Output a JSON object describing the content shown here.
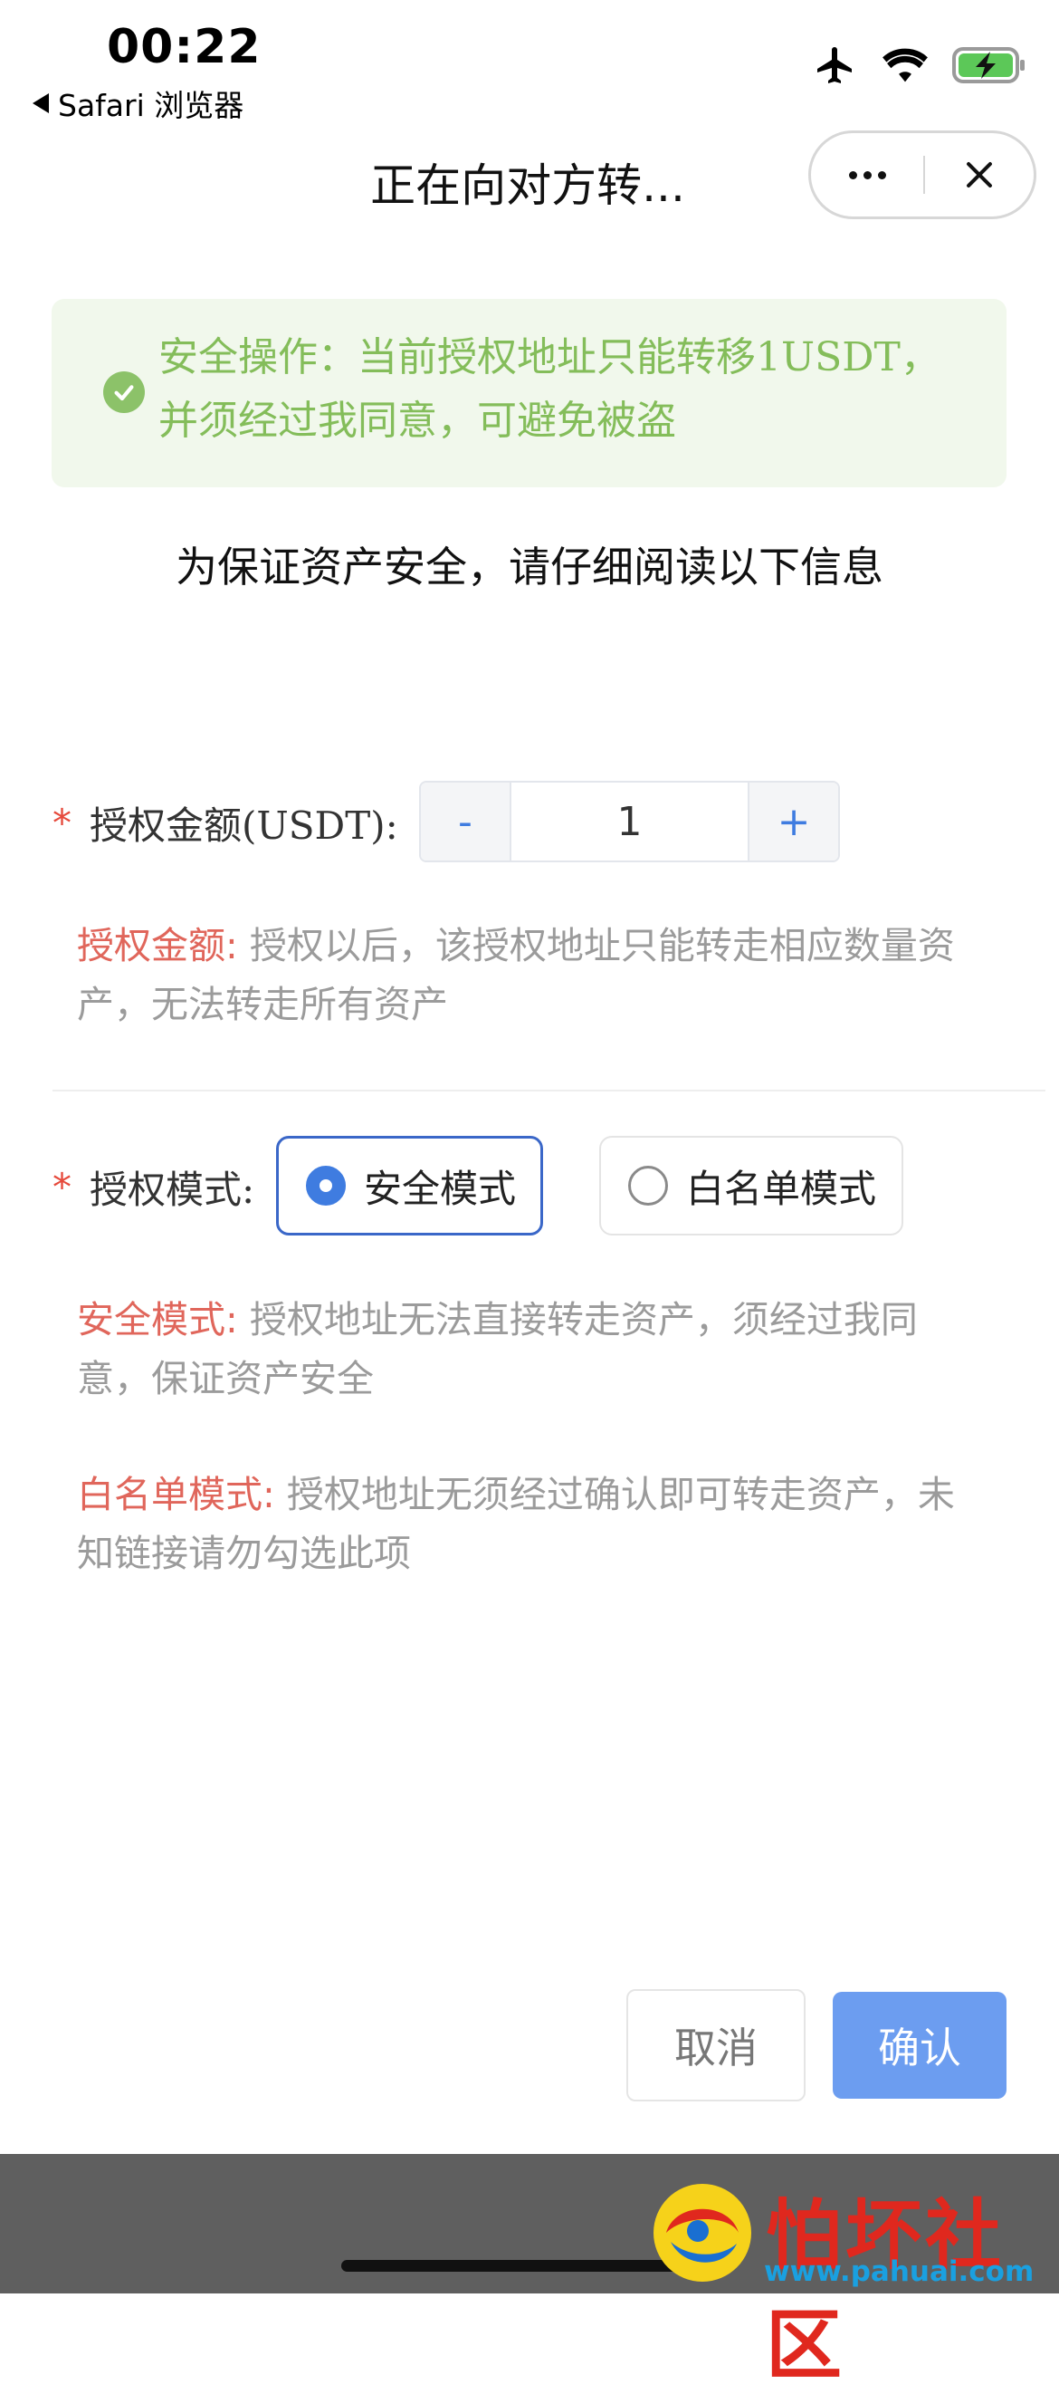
{
  "status_bar": {
    "time": "00:22",
    "back_app": "Safari 浏览器"
  },
  "nav": {
    "title": "正在向对方转..."
  },
  "notice": {
    "text": "安全操作：当前授权地址只能转移1USDT，并须经过我同意，可避免被盗"
  },
  "read_hint": "为保证资产安全，请仔细阅读以下信息",
  "amount": {
    "required_mark": "*",
    "label": "授权金额(USDT):",
    "minus": "-",
    "value": "1",
    "plus": "+",
    "desc_title": "授权金额:",
    "desc_text": " 授权以后，该授权地址只能转走相应数量资产，无法转走所有资产"
  },
  "mode": {
    "required_mark": "*",
    "label": "授权模式:",
    "options": [
      {
        "label": "安全模式",
        "selected": true
      },
      {
        "label": "白名单模式",
        "selected": false
      }
    ],
    "safe_desc_title": "安全模式:",
    "safe_desc_text": " 授权地址无法直接转走资产，须经过我同意，保证资产安全",
    "white_desc_title": "白名单模式:",
    "white_desc_text": " 授权地址无须经过确认即可转走资产，未知链接请勿勾选此项"
  },
  "buttons": {
    "cancel": "取消",
    "confirm": "确认"
  },
  "watermark": {
    "title": "怕坏社区",
    "url": "www.pahuai.com"
  },
  "colors": {
    "accent": "#3f7ce0",
    "confirm": "#6c9df0",
    "notice_text": "#84bd5a",
    "highlight": "#e0665b"
  }
}
